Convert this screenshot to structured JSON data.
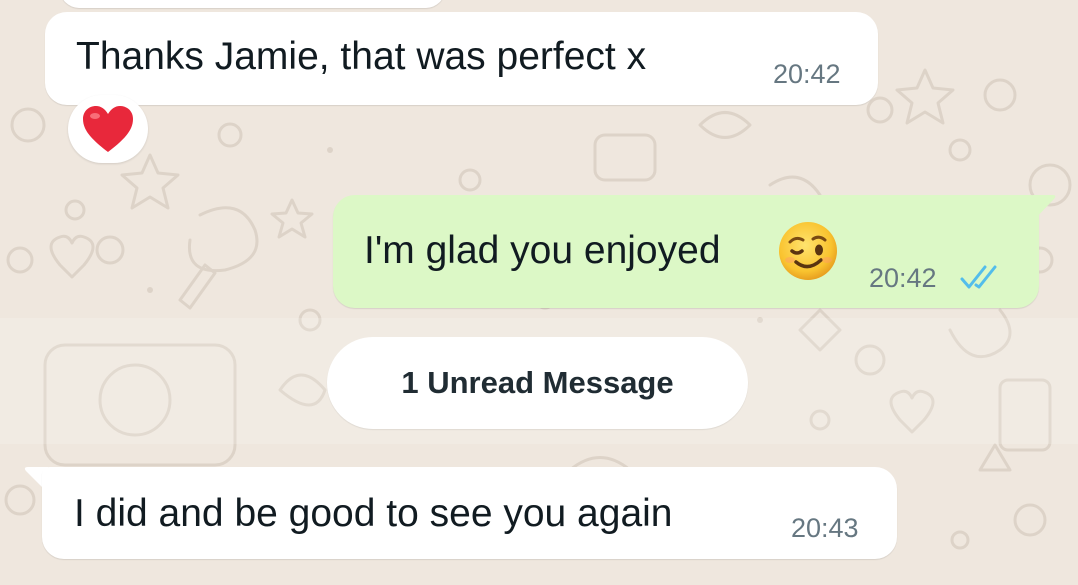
{
  "messages": [
    {
      "direction": "incoming",
      "text": "Thanks Jamie, that was perfect x",
      "time": "20:42",
      "reaction": "red-heart"
    },
    {
      "direction": "outgoing",
      "text": "I'm glad you enjoyed",
      "emoji": "winking-face",
      "time": "20:42",
      "status": "read-double-tick"
    },
    {
      "direction": "incoming",
      "text": "I did and be good to see you again",
      "time": "20:43"
    }
  ],
  "divider": {
    "label": "1 Unread Message"
  },
  "colors": {
    "background": "#efe7de",
    "incoming_bubble": "#ffffff",
    "outgoing_bubble": "#dcf8c6",
    "timestamp": "#667781",
    "read_ticks": "#53bdeb",
    "heart": "#e8283b"
  }
}
